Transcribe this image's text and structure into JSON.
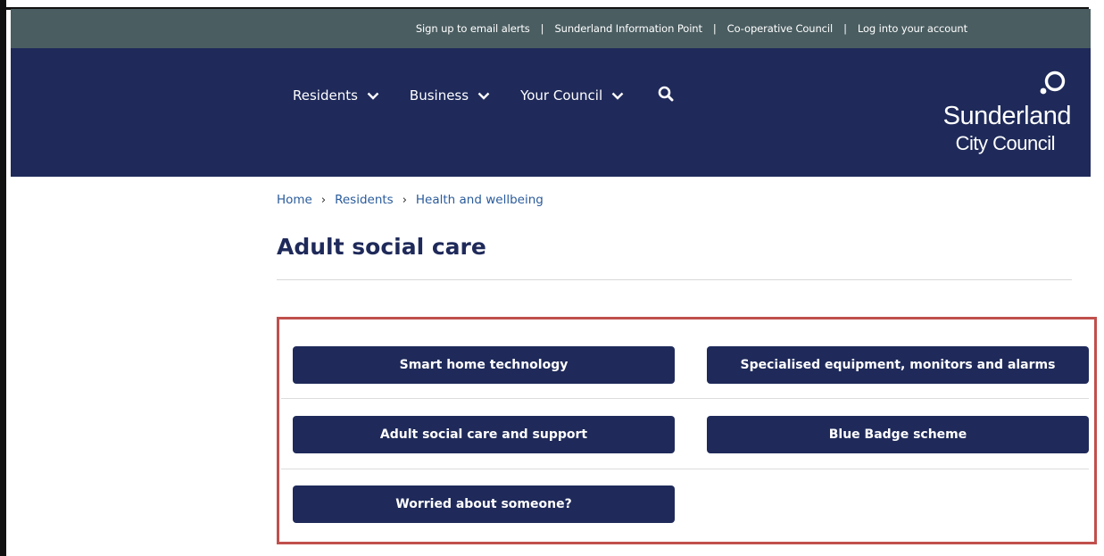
{
  "utility_links": [
    "Sign up to email alerts",
    "Sunderland Information Point",
    "Co-operative Council",
    "Log into your account"
  ],
  "nav": {
    "residents": "Residents",
    "business": "Business",
    "your_council": "Your Council"
  },
  "logo": {
    "line1": "Sunderland",
    "line2": "City Council"
  },
  "breadcrumb": {
    "home": "Home",
    "residents": "Residents",
    "health": "Health and wellbeing",
    "separator": "›"
  },
  "page_title": "Adult social care",
  "cards": {
    "smart_home": "Smart home technology",
    "equipment": "Specialised equipment, monitors and alarms",
    "support": "Adult social care and support",
    "blue_badge": "Blue Badge scheme",
    "worried": "Worried about someone?"
  },
  "colors": {
    "utility_bar": "#4a5d61",
    "header": "#1f2a5a",
    "link": "#2a5b9b",
    "highlight": "#c0504d"
  }
}
